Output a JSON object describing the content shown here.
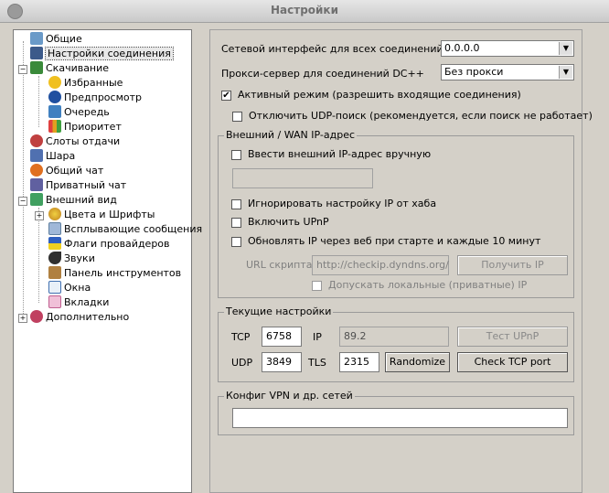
{
  "window": {
    "title": "Настройки"
  },
  "tree": {
    "items": [
      {
        "label": "Общие"
      },
      {
        "label": "Настройки соединения"
      },
      {
        "label": "Скачивание"
      },
      {
        "label": "Избранные"
      },
      {
        "label": "Предпросмотр"
      },
      {
        "label": "Очередь"
      },
      {
        "label": "Приоритет"
      },
      {
        "label": "Слоты отдачи"
      },
      {
        "label": "Шара"
      },
      {
        "label": "Общий чат"
      },
      {
        "label": "Приватный чат"
      },
      {
        "label": "Внешний вид"
      },
      {
        "label": "Цвета и Шрифты"
      },
      {
        "label": "Всплывающие сообщения"
      },
      {
        "label": "Флаги провайдеров"
      },
      {
        "label": "Звуки"
      },
      {
        "label": "Панель инструментов"
      },
      {
        "label": "Окна"
      },
      {
        "label": "Вкладки"
      },
      {
        "label": "Дополнительно"
      }
    ]
  },
  "settings": {
    "iface_label": "Сетевой интерфейс для всех соединений",
    "iface_value": "0.0.0.0",
    "proxy_label": "Прокси-сервер для соединений DC++",
    "proxy_value": "Без прокси",
    "active_mode": {
      "label": "Активный режим (разрешить входящие соединения)",
      "checked": "✔"
    },
    "disable_udp": {
      "label": "Отключить UDP-поиск (рекомендуется, если поиск не работает)"
    }
  },
  "wan": {
    "title": "Внешний / WAN IP-адрес",
    "manual_ip_label": "Ввести внешний IP-адрес вручную",
    "manual_ip_value": "",
    "ignore_hub_label": "Игнорировать настройку IP от хаба",
    "upnp_label": "Включить UPnP",
    "update_web_label": "Обновлять IP через веб при старте и каждые 10 минут",
    "url_label": "URL скрипта:",
    "url_value": "http://checkip.dyndns.org/",
    "get_ip_button": "Получить IP",
    "allow_local_label": "Допускать локальные (приватные) IP"
  },
  "current": {
    "title": "Текущие настройки",
    "tcp_label": "TCP",
    "tcp_value": "6758",
    "ip_label": "IP",
    "ip_value": "89.2",
    "test_upnp_button": "Тест UPnP",
    "udp_label": "UDP",
    "udp_value": "3849",
    "tls_label": "TLS",
    "tls_value": "2315",
    "randomize_button": "Randomize",
    "check_tcp_button": "Check TCP port"
  },
  "vpn": {
    "title": "Конфиг VPN и др. сетей",
    "value": ""
  },
  "colors": {
    "background": "#d4d0c8",
    "tree_background": "#ffffff",
    "disabled_text": "#808080"
  }
}
